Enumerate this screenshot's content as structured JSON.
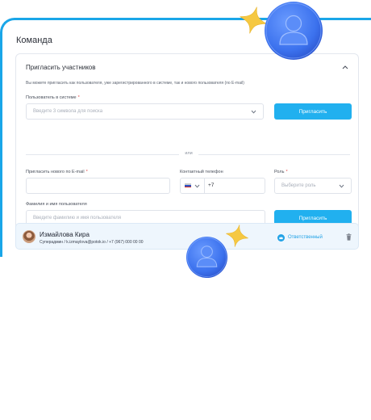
{
  "page": {
    "title": "Команда"
  },
  "invite": {
    "title": "Пригласить участников",
    "hint": "Вы можете пригласить как пользователя, уже зарегистрированного в системе, так и нового пользователя (по E-mail)",
    "existing": {
      "label": "Пользователь в системе",
      "required_mark": "*",
      "placeholder": "Введите 3 символа для поиска",
      "button": "Пригласить"
    },
    "divider_label": "или",
    "new_user": {
      "email_label": "Пригласить нового по E-mail",
      "email_required_mark": "*",
      "phone_label": "Контактный телефон",
      "phone_code": "+7",
      "role_label": "Роль",
      "role_required_mark": "*",
      "role_placeholder": "Выберите роль",
      "name_label": "Фамилия и имя пользователя",
      "name_placeholder": "Введите фамилию и имя пользователя",
      "button": "Пригласить"
    }
  },
  "members": [
    {
      "name": "Измайлова Кира",
      "meta": "Суперадмин / k.izmaylova@potok.io / +7 (967) 000 00 00",
      "role": "Ответственный",
      "role_icon": "crown-icon"
    }
  ],
  "colors": {
    "accent": "#21b0ef",
    "frame": "#1aa6e8",
    "badge": "#3d78f0",
    "star": "#f5c842"
  }
}
